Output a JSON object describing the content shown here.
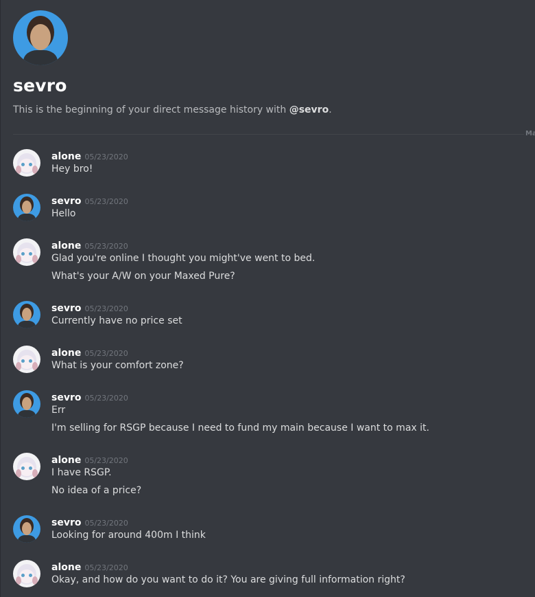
{
  "dm": {
    "username": "sevro",
    "intro_prefix": "This is the beginning of your direct message history with ",
    "intro_mention": "@sevro",
    "intro_suffix": ".",
    "divider_label": "Ma"
  },
  "colors": {
    "background": "#36393f",
    "username": "#ffffff",
    "timestamp": "#72767d",
    "message_text": "#dcddde",
    "sevro_avatar_bg": "#3e9be3"
  },
  "messages": [
    {
      "author": "alone",
      "timestamp": "05/23/2020",
      "lines": [
        "Hey bro!"
      ]
    },
    {
      "author": "sevro",
      "timestamp": "05/23/2020",
      "lines": [
        "Hello"
      ]
    },
    {
      "author": "alone",
      "timestamp": "05/23/2020",
      "lines": [
        "Glad you're online I thought you might've went to bed.",
        "What's your A/W on your Maxed Pure?"
      ]
    },
    {
      "author": "sevro",
      "timestamp": "05/23/2020",
      "lines": [
        "Currently have no price set"
      ]
    },
    {
      "author": "alone",
      "timestamp": "05/23/2020",
      "lines": [
        "What is your comfort zone?"
      ]
    },
    {
      "author": "sevro",
      "timestamp": "05/23/2020",
      "lines": [
        "Err",
        "I'm selling for RSGP because I need to fund my main because I want to max it."
      ]
    },
    {
      "author": "alone",
      "timestamp": "05/23/2020",
      "lines": [
        "I have RSGP.",
        "No idea of a price?"
      ]
    },
    {
      "author": "sevro",
      "timestamp": "05/23/2020",
      "lines": [
        "Looking for around 400m I think"
      ]
    },
    {
      "author": "alone",
      "timestamp": "05/23/2020",
      "lines": [
        "Okay, and how do you want to do it? You are giving full information right?"
      ]
    }
  ]
}
